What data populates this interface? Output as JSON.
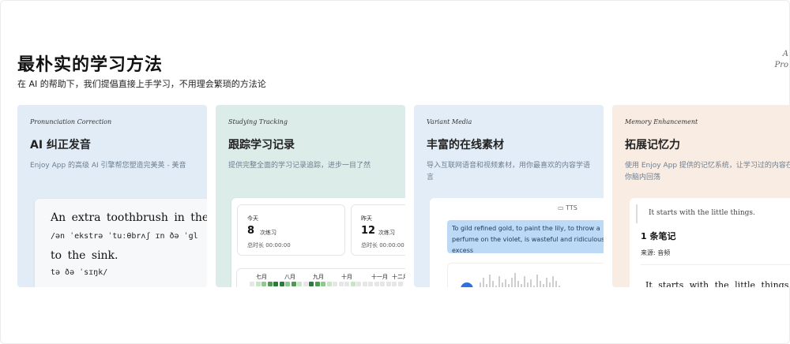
{
  "header": {
    "title": "最朴实的学习方法",
    "subtitle": "在 AI 的帮助下，我们提倡直接上手学习，不用理会繁琐的方法论",
    "corner_line1": "A",
    "corner_line2": "Pro"
  },
  "cards": [
    {
      "tag": "Pronunciation Correction",
      "title": "AI 纠正发音",
      "desc": "Enjoy App 的高级 AI 引擎帮您塑造完美英 - 美音",
      "sample": {
        "line1": "An extra  toothbrush in the gla",
        "ipa1": "/ən ˈekstrə ˈtuːθbrʌʃ  ɪn ðə ˈgl",
        "line2": "to the sink.",
        "ipa2": "tə ðə ˈsɪŋk/"
      }
    },
    {
      "tag": "Studying Tracking",
      "title": "跟踪学习记录",
      "desc": "提供完整全面的学习记录追踪，进步一目了然",
      "stats": [
        {
          "label": "今天",
          "value": "8",
          "unit": "次练习",
          "duration": "总时长 00:00:00"
        },
        {
          "label": "昨天",
          "value": "12",
          "unit": "次练习",
          "duration": "总时长 00:00:00"
        }
      ],
      "months": [
        "七月",
        "八月",
        "九月",
        "十月",
        "十一月",
        "十二月"
      ],
      "heat_colors": [
        "#2d7a3a",
        "#4f9b55",
        "#8fca8d",
        "#c6e7c3",
        "#e6e6e6"
      ]
    },
    {
      "tag": "Variant Media",
      "title": "丰富的在线素材",
      "desc": "导入互联网语音和视频素材，用你最喜欢的内容学语言",
      "tts_label": "TTS",
      "bubble_text": "To gild refined gold, to paint the lily, to throw a perfume on the violet, is wasteful and ridiculous excess"
    },
    {
      "tag": "Memory Enhancement",
      "title": "拓展记忆力",
      "desc": "使用 Enjoy App 提供的记忆系统，让学习过的内容在你脑内回荡",
      "quote": "It starts with the little things.",
      "note_count": "1",
      "note_label": "条笔记",
      "source": "来源: 音频",
      "sample": "It starts  with the little things."
    }
  ],
  "colors": {
    "card1": "#e1ecf6",
    "card2": "#dcece8",
    "card3": "#e2edf7",
    "card4": "#f8ece3"
  }
}
